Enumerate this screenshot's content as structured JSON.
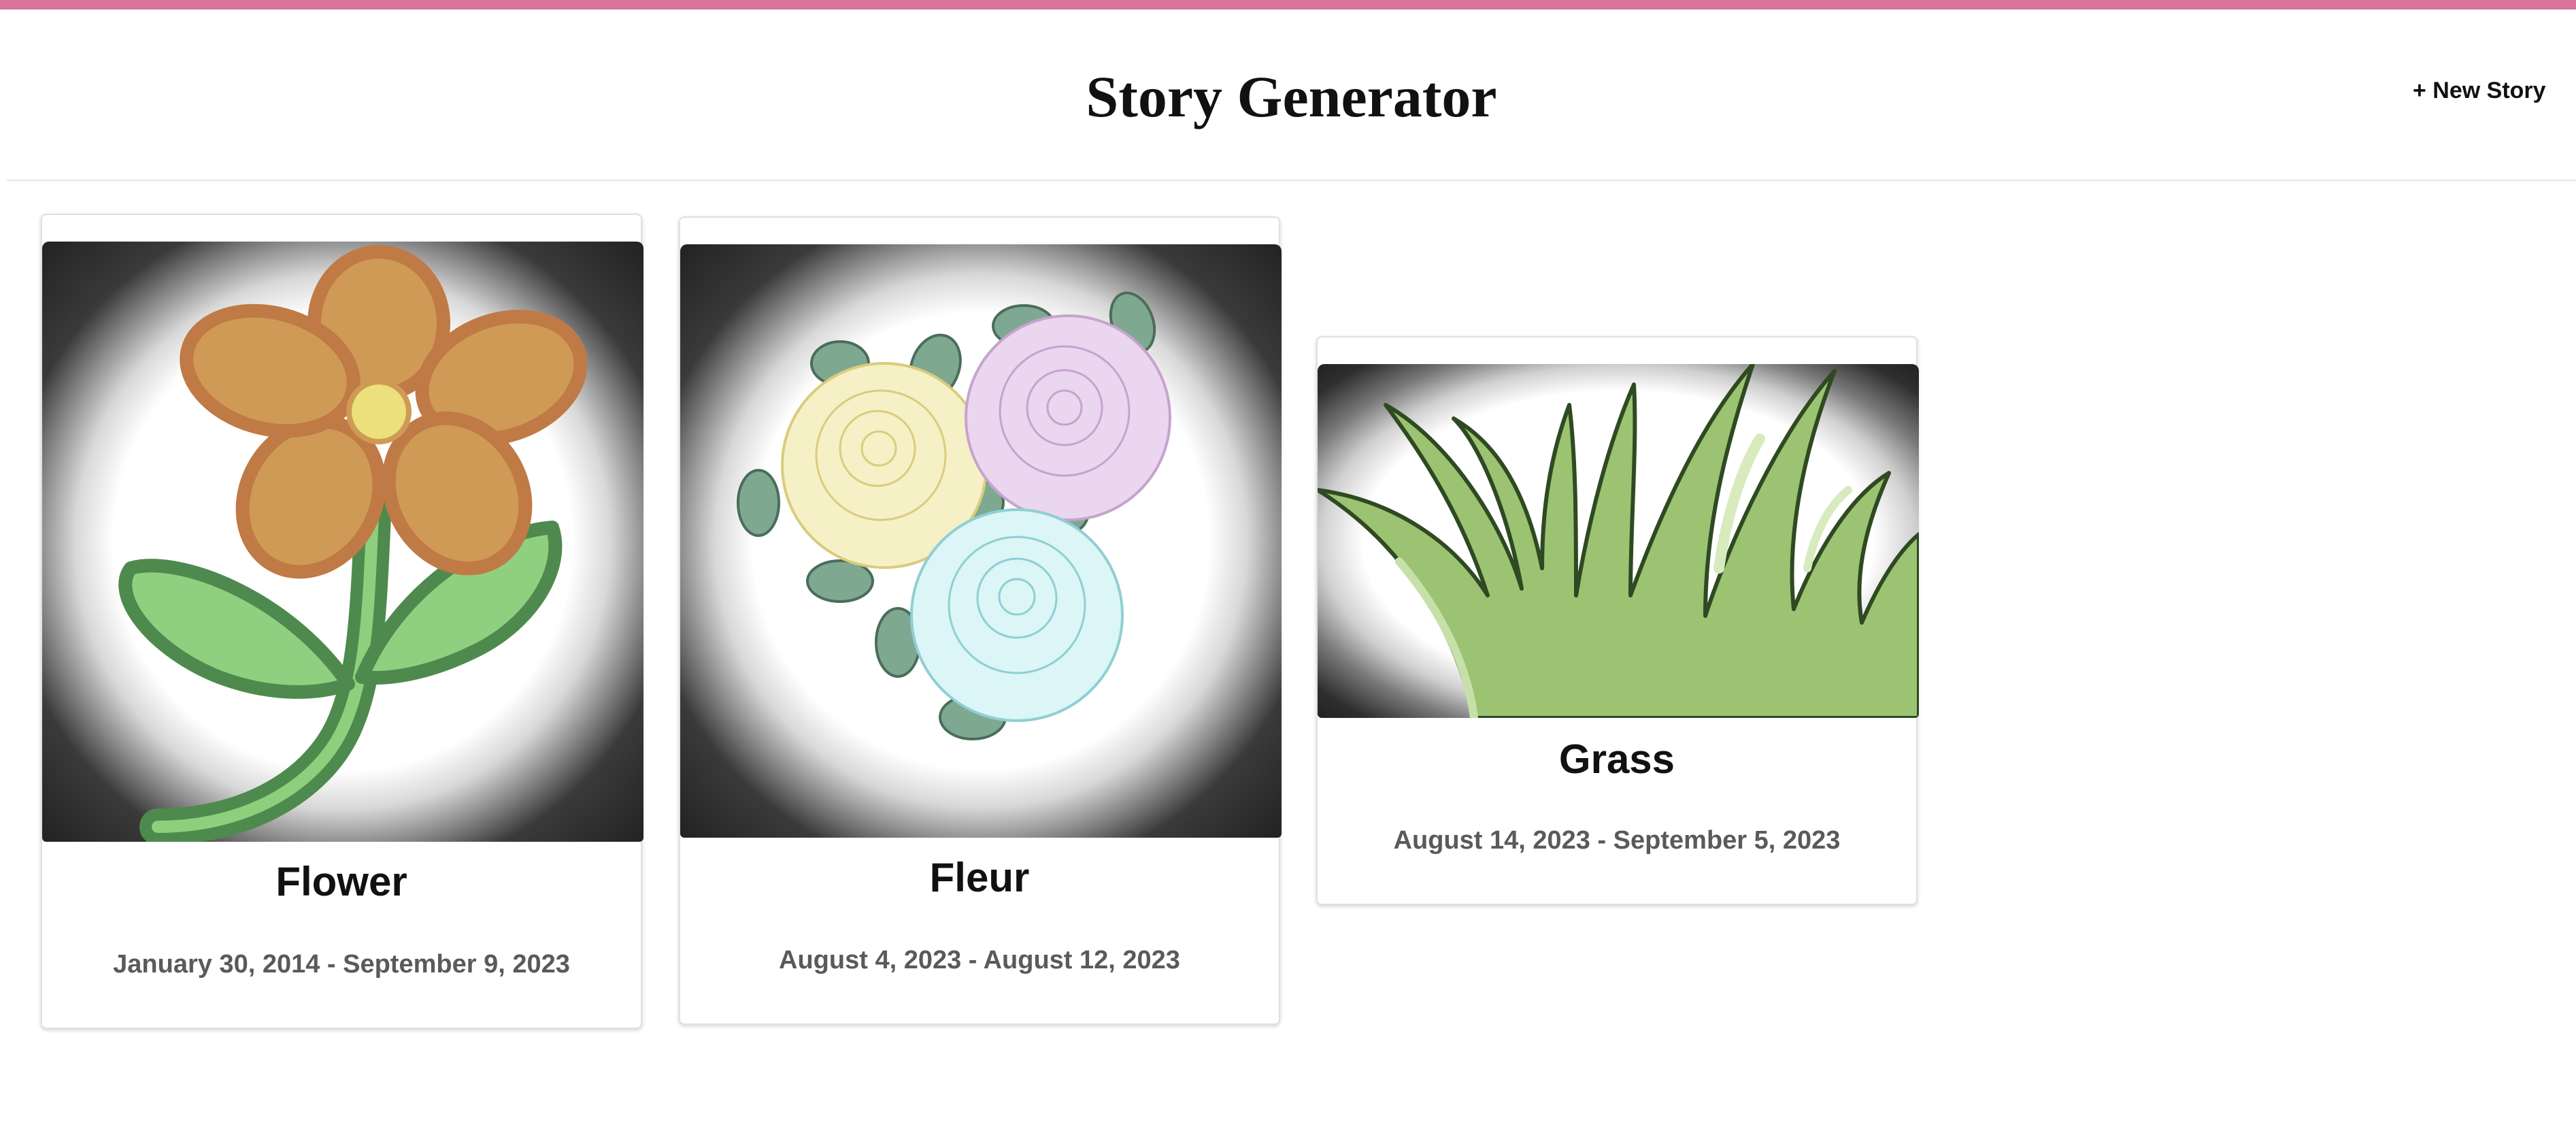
{
  "app": {
    "title": "Story Generator",
    "new_story_label": "+ New Story",
    "accent_color": "#d9739a"
  },
  "stories": [
    {
      "title": "Flower",
      "dates": "January 30, 2014 - September 9, 2023",
      "image_icon": "flower-icon"
    },
    {
      "title": "Fleur",
      "dates": "August 4, 2023 - August 12, 2023",
      "image_icon": "roses-icon"
    },
    {
      "title": "Grass",
      "dates": "August 14, 2023 - September 5, 2023",
      "image_icon": "grass-icon"
    }
  ]
}
